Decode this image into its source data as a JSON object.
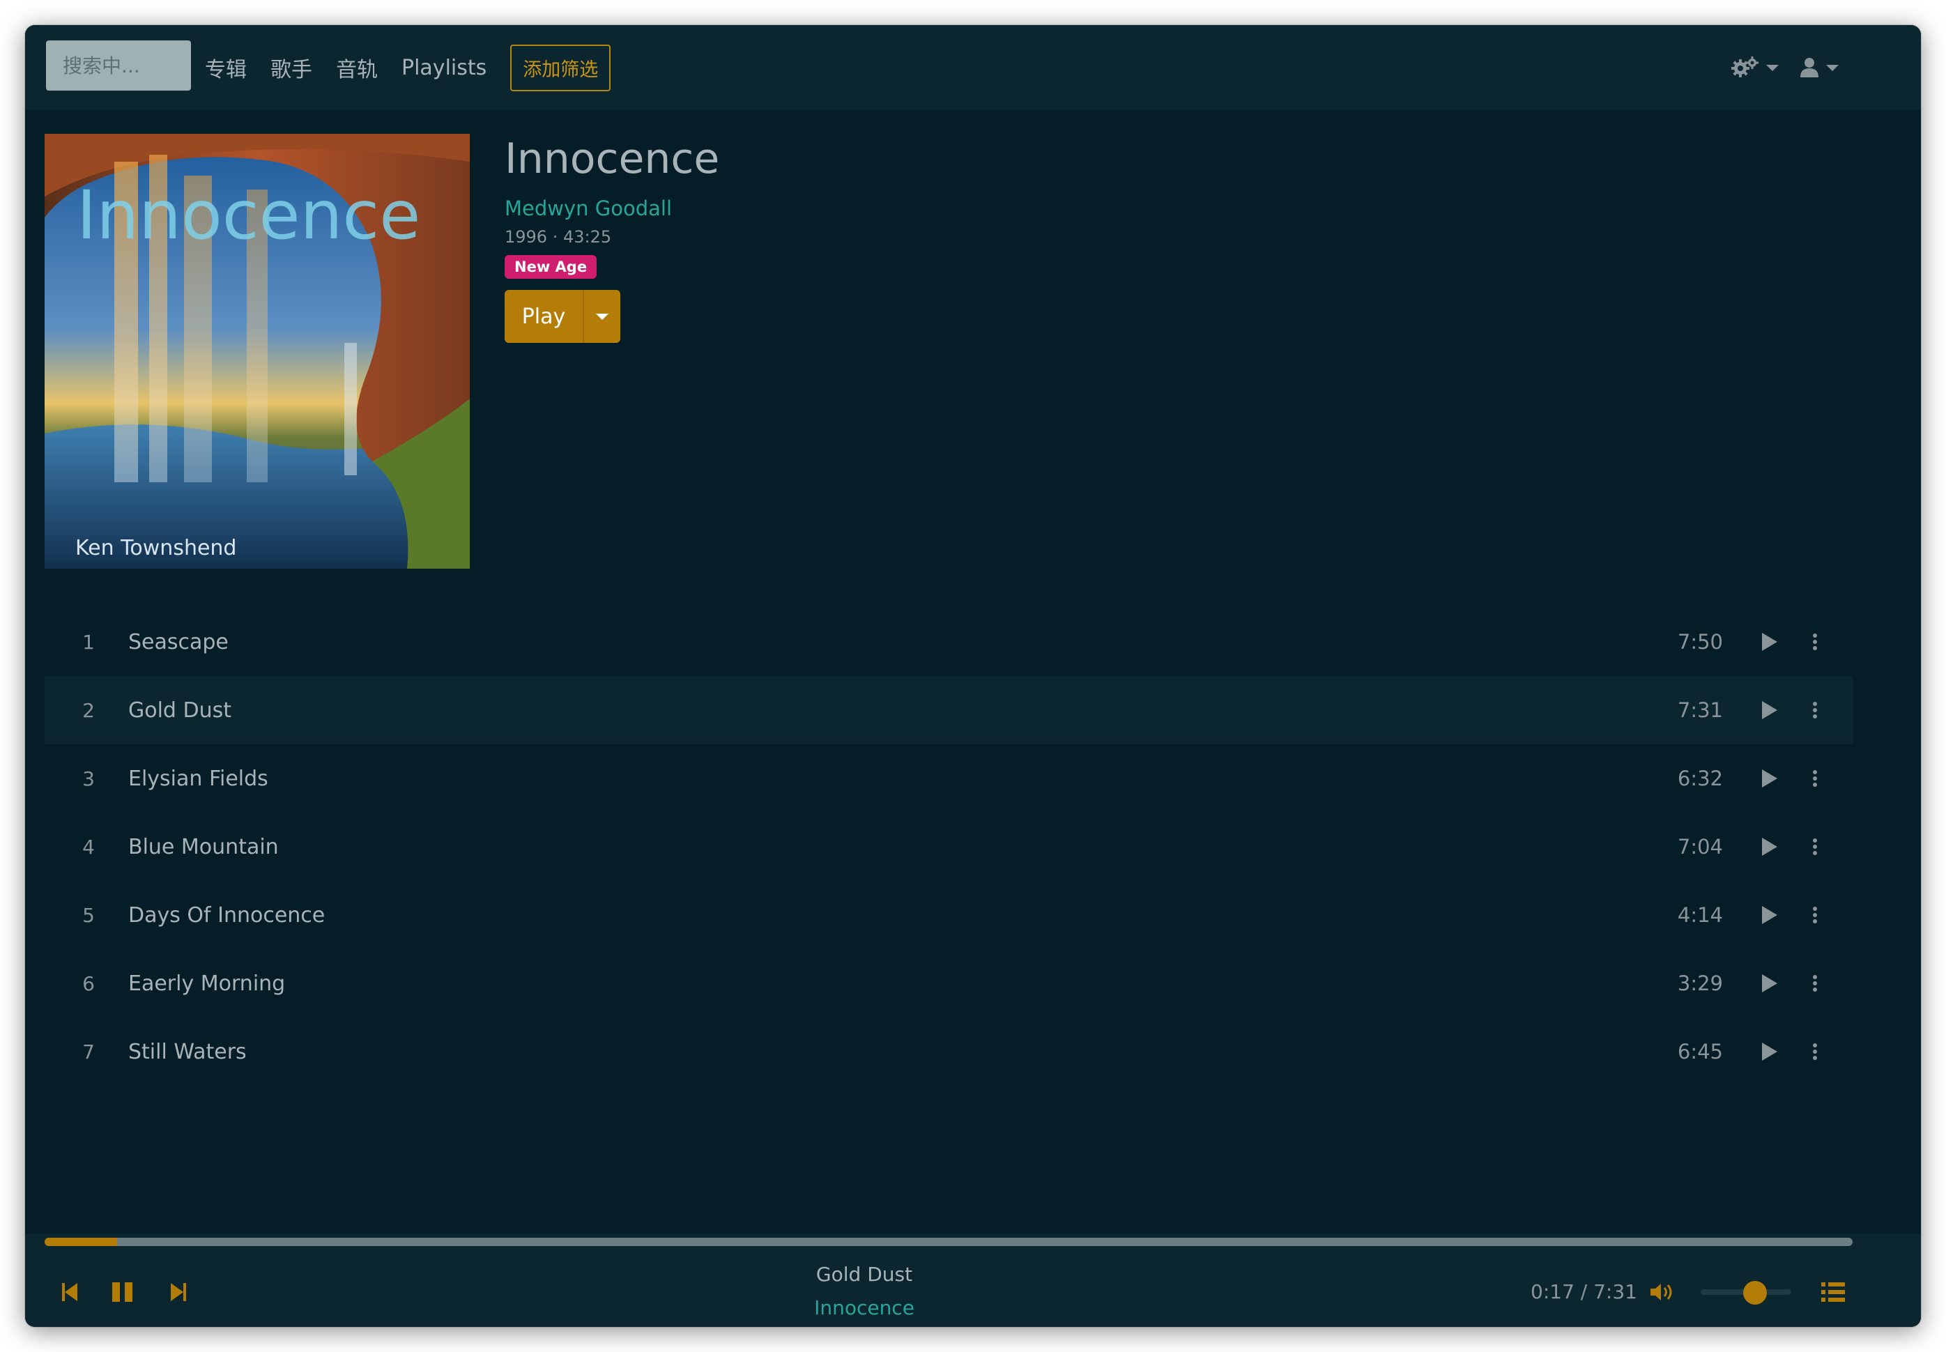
{
  "navbar": {
    "search_placeholder": "搜索中...",
    "links": [
      "专辑",
      "歌手",
      "音轨",
      "Playlists"
    ],
    "filter_label": "添加筛选",
    "settings_icon": "gears-icon",
    "user_icon": "user-icon"
  },
  "album": {
    "title": "Innocence",
    "artist": "Medwyn Goodall",
    "meta": "1996 · 43:25",
    "genre": "New Age",
    "play_label": "Play",
    "cover_title": "Innocence",
    "cover_credit": "Ken Townshend"
  },
  "tracks": [
    {
      "num": "1",
      "title": "Seascape",
      "duration": "7:50"
    },
    {
      "num": "2",
      "title": "Gold Dust",
      "duration": "7:31"
    },
    {
      "num": "3",
      "title": "Elysian Fields",
      "duration": "6:32"
    },
    {
      "num": "4",
      "title": "Blue Mountain",
      "duration": "7:04"
    },
    {
      "num": "5",
      "title": "Days Of Innocence",
      "duration": "4:14"
    },
    {
      "num": "6",
      "title": "Eaerly Morning",
      "duration": "3:29"
    },
    {
      "num": "7",
      "title": "Still Waters",
      "duration": "6:45"
    }
  ],
  "player": {
    "now_title": "Gold Dust",
    "now_album": "Innocence",
    "time": "0:17 / 7:31",
    "progress": 0.04,
    "volume": 0.6
  },
  "colors": {
    "background": "#051d26",
    "accent": "#b47d08",
    "link": "#26a69a",
    "genre_badge": "#d01e6e"
  }
}
